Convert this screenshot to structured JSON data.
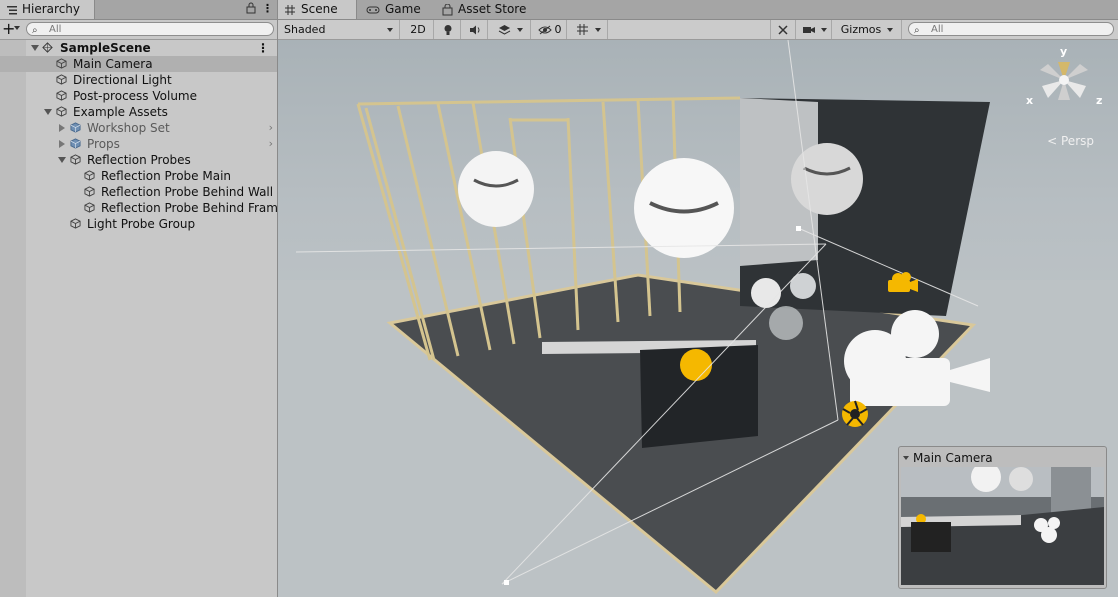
{
  "hierarchy": {
    "tab_label": "Hierarchy",
    "search_placeholder": "All",
    "items": [
      {
        "label": "SampleScene",
        "depth": 0,
        "expanded": true,
        "bold": true,
        "selected": false
      },
      {
        "label": "Main Camera",
        "depth": 1,
        "selected": true
      },
      {
        "label": "Directional Light",
        "depth": 1,
        "selected": false
      },
      {
        "label": "Post-process Volume",
        "depth": 1,
        "selected": false
      },
      {
        "label": "Example Assets",
        "depth": 1,
        "expanded": true,
        "selected": false
      },
      {
        "label": "Workshop Set",
        "depth": 2,
        "collapsed": true,
        "prefab": true,
        "selected": false
      },
      {
        "label": "Props",
        "depth": 2,
        "collapsed": true,
        "prefab": true,
        "selected": false
      },
      {
        "label": "Reflection Probes",
        "depth": 2,
        "expanded": true,
        "selected": false
      },
      {
        "label": "Reflection Probe Main",
        "depth": 3,
        "selected": false
      },
      {
        "label": "Reflection Probe Behind Wall",
        "depth": 3,
        "selected": false
      },
      {
        "label": "Reflection Probe Behind Frame",
        "depth": 3,
        "selected": false
      },
      {
        "label": "Light Probe Group",
        "depth": 2,
        "selected": false
      }
    ]
  },
  "scene": {
    "tabs": [
      {
        "label": "Scene",
        "active": true
      },
      {
        "label": "Game",
        "active": false
      },
      {
        "label": "Asset Store",
        "active": false
      }
    ],
    "toolbar": {
      "shading_mode": "Shaded",
      "mode_2d": "2D",
      "hidden_count": "0",
      "gizmos_label": "Gizmos",
      "search_placeholder": "All"
    },
    "projection_label": "Persp",
    "axis_labels": {
      "x": "x",
      "y": "y",
      "z": "z"
    },
    "camera_preview_title": "Main Camera"
  },
  "colors": {
    "accent_yellow": "#f5b800",
    "panel_bg": "#c8c8c8",
    "selection": "#b0b0b0"
  }
}
